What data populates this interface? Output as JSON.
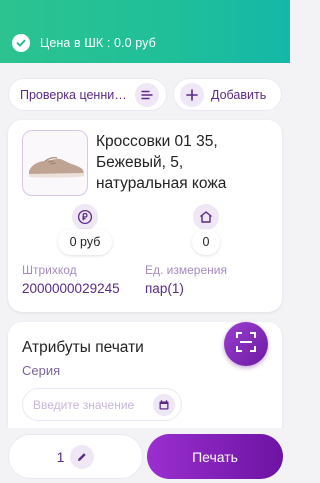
{
  "status_bar": {
    "text": "Цена в ШК : 0.0 руб"
  },
  "actions": {
    "check_price_label": "Проверка ценни…",
    "add_label": "Добавить"
  },
  "product": {
    "name": "Кроссовки 01 35, Бежевый, 5, натуральная кожа",
    "price_value": "0 руб",
    "stock_value": "0",
    "barcode_label": "Штрихкод",
    "barcode_value": "2000000029245",
    "unit_label": "Ед. измерения",
    "unit_value": "пар(1)"
  },
  "print_attributes": {
    "title": "Атрибуты печати",
    "series_label": "Серия",
    "series_placeholder": "Введите значение"
  },
  "footer": {
    "quantity": "1",
    "print_label": "Печать"
  },
  "colors": {
    "header_green": "#2cc38f",
    "accent_purple": "#7b1fa2",
    "label_purple": "#a68ac4"
  },
  "icons": {
    "status": "check-circle-icon",
    "check_price": "sort-list-icon",
    "add": "plus-icon",
    "price": "ruble-icon",
    "stock": "home-icon",
    "scan": "barcode-scan-icon",
    "calendar": "calendar-icon",
    "edit": "pencil-icon"
  }
}
